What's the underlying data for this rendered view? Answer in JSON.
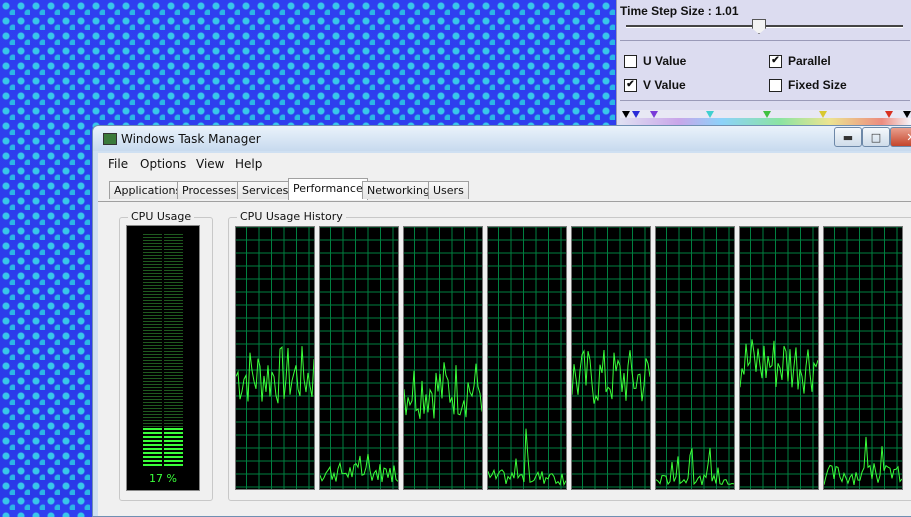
{
  "panel": {
    "time_step_label": "Time Step Size : 1.01",
    "checkboxes": [
      {
        "label": "U Value",
        "checked": false
      },
      {
        "label": "Parallel",
        "checked": true
      },
      {
        "label": "V Value",
        "checked": true
      },
      {
        "label": "Fixed Size",
        "checked": false
      }
    ],
    "colorbar_marker_colors": [
      "#000000",
      "#2b2bd8",
      "#7a3ad8",
      "#40d0d0",
      "#40c040",
      "#d8c830",
      "#d83020",
      "#000000"
    ]
  },
  "taskmanager": {
    "title": "Windows Task Manager",
    "menu": [
      "File",
      "Options",
      "View",
      "Help"
    ],
    "tabs": [
      "Applications",
      "Processes",
      "Services",
      "Performance",
      "Networking",
      "Users"
    ],
    "active_tab": "Performance",
    "cpu_usage_title": "CPU Usage",
    "cpu_usage_value": "17 %",
    "cpu_usage_percent": 17,
    "history_title": "CPU Usage History",
    "history_graph_count": 8
  }
}
